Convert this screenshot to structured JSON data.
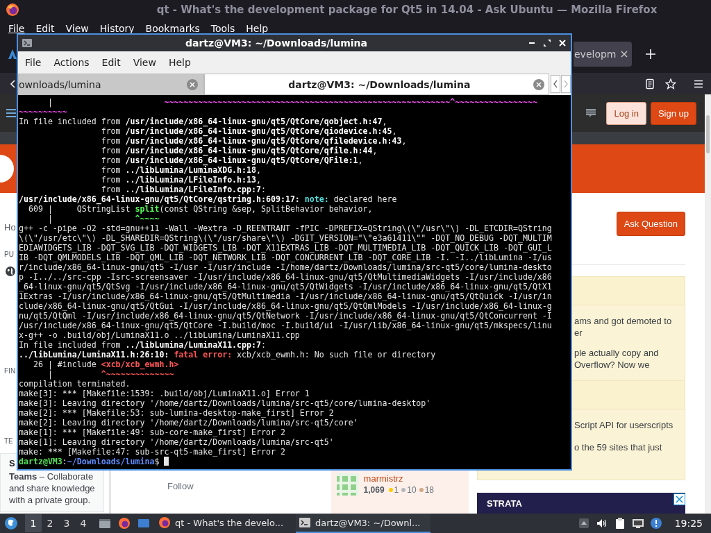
{
  "firefox": {
    "title": "qt - What's the development package for Qt5 in 14.04 - Ask Ubuntu — Mozilla Firefox",
    "menu": [
      "File",
      "Edit",
      "View",
      "History",
      "Bookmarks",
      "Tools",
      "Help"
    ],
    "tabs": [
      {
        "label": "evelopm",
        "selected": true
      }
    ],
    "page": {
      "header": {
        "login": "Log in",
        "signup": "Sign up"
      },
      "left_column": {
        "link": "Ho",
        "heading_1": "PU",
        "heading_2": "FIN",
        "heading_3": "TE",
        "card": {
          "title": "S",
          "text": "**Teams** – Collaborate and share knowledge with a private group."
        }
      },
      "main": {
        "follow": "Follow",
        "user_card": {
          "name": "marmistrz",
          "reputation": "1,069",
          "badges": [
            {
              "count": "1",
              "color": "#ffcc01"
            },
            {
              "count": "10",
              "color": "#b4b8bc"
            },
            {
              "count": "18",
              "color": "#d1a684"
            }
          ]
        }
      },
      "right_column": {
        "ask_button": "Ask Question",
        "sidebar_box": {
          "sections": [
            {
              "items": [
                {
                  "lines": [
                    "ams and got demoted to",
                    "er"
                  ]
                },
                {
                  "lines": [
                    "ple actually copy and",
                    "Overflow? Now we"
                  ]
                }
              ]
            },
            {
              "items": [
                {
                  "lines": [
                    "Script API for userscripts"
                  ]
                },
                {
                  "lines": [
                    "o the 59 sites that just"
                  ]
                }
              ]
            }
          ]
        },
        "ad": {
          "text": "STRATA"
        }
      }
    }
  },
  "terminal": {
    "title": "dartz@VM3: ~/Downloads/lumina",
    "menu": [
      "File",
      "Actions",
      "Edit",
      "View",
      "Help"
    ],
    "tabs": [
      {
        "label": "ownloads/lumina",
        "selected": false
      },
      {
        "label": "dartz@VM3: ~/Downloads/lumina",
        "selected": true
      }
    ],
    "lines": [
      [
        "      |                       ",
        {
          "kind": "magenta",
          "text": "~~~~~~~~~~~~~~~~~~~~~~~~~~~~~~~~~~~~~~~~~~~~~~~~~~~~~~~~~~~^~~~~~~~~~~~~~~~~~"
        }
      ],
      [
        {
          "kind": "magenta",
          "text": "~~~~~~~~~~"
        }
      ],
      [
        "In file included from ",
        {
          "kind": "bold",
          "text": "/usr/include/x86_64-linux-gnu/qt5/QtCore/qobject.h:47"
        },
        ","
      ],
      [
        "                 from ",
        {
          "kind": "bold",
          "text": "/usr/include/x86_64-linux-gnu/qt5/QtCore/qiodevice.h:45"
        },
        ","
      ],
      [
        "                 from ",
        {
          "kind": "bold",
          "text": "/usr/include/x86_64-linux-gnu/qt5/QtCore/qfiledevice.h:43"
        },
        ","
      ],
      [
        "                 from ",
        {
          "kind": "bold",
          "text": "/usr/include/x86_64-linux-gnu/qt5/QtCore/qfile.h:44"
        },
        ","
      ],
      [
        "                 from ",
        {
          "kind": "bold",
          "text": "/usr/include/x86_64-linux-gnu/qt5/QtCore/QFile:1"
        },
        ","
      ],
      [
        "                 from ",
        {
          "kind": "bold",
          "text": "../libLumina/LuminaXDG.h:18"
        },
        ","
      ],
      [
        "                 from ",
        {
          "kind": "bold",
          "text": "../libLumina/LFileInfo.h:13"
        },
        ","
      ],
      [
        "                 from ",
        {
          "kind": "bold",
          "text": "../libLumina/LFileInfo.cpp:7"
        },
        ":"
      ],
      [
        {
          "kind": "bold",
          "text": "/usr/include/x86_64-linux-gnu/qt5/QtCore/qstring.h:609:17: "
        },
        {
          "kind": "note",
          "text": "note:"
        },
        " declared here"
      ],
      [
        "  609 |     QStringList ",
        {
          "kind": "green",
          "text": "split"
        },
        "(const QString &sep, SplitBehavior behavior,"
      ],
      [
        "      |                 ",
        {
          "kind": "green",
          "text": "^~~~~"
        }
      ],
      [
        "g++ -c -pipe -O2 -std=gnu++11 -Wall -Wextra -D_REENTRANT -fPIC -DPREFIX=QString\\(\\\"/usr\\\"\\) -DL_ETCDIR=QString"
      ],
      [
        "\\(\\\"/usr/etc\\\"\\) -DL_SHAREDIR=QString\\(\\\"/usr/share\\\"\\) -DGIT_VERSION=\"\\\"e3a61411\\\"\" -DQT_NO_DEBUG -DQT_MULTIM"
      ],
      [
        "EDIAWIDGETS_LIB -DQT_SVG_LIB -DQT_WIDGETS_LIB -DQT_X11EXTRAS_LIB -DQT_MULTIMEDIA_LIB -DQT_QUICK_LIB -DQT_GUI_L"
      ],
      [
        "IB -DQT_QMLMODELS_LIB -DQT_QML_LIB -DQT_NETWORK_LIB -DQT_CONCURRENT_LIB -DQT_CORE_LIB -I. -I../libLumina -I/us"
      ],
      [
        "r/include/x86_64-linux-gnu/qt5 -I/usr -I/usr/include -I/home/dartz/Downloads/lumina/src-qt5/core/lumina-deskto"
      ],
      [
        "p -I../../src-cpp -Isrc-screensaver -I/usr/include/x86_64-linux-gnu/qt5/QtMultimediaWidgets -I/usr/include/x86"
      ],
      [
        "_64-linux-gnu/qt5/QtSvg -I/usr/include/x86_64-linux-gnu/qt5/QtWidgets -I/usr/include/x86_64-linux-gnu/qt5/QtX1"
      ],
      [
        "1Extras -I/usr/include/x86_64-linux-gnu/qt5/QtMultimedia -I/usr/include/x86_64-linux-gnu/qt5/QtQuick -I/usr/in"
      ],
      [
        "clude/x86_64-linux-gnu/qt5/QtGui -I/usr/include/x86_64-linux-gnu/qt5/QtQmlModels -I/usr/include/x86_64-linux-g"
      ],
      [
        "nu/qt5/QtQml -I/usr/include/x86_64-linux-gnu/qt5/QtNetwork -I/usr/include/x86_64-linux-gnu/qt5/QtConcurrent -I"
      ],
      [
        "/usr/include/x86_64-linux-gnu/qt5/QtCore -I.build/moc -I.build/ui -I/usr/lib/x86_64-linux-gnu/qt5/mkspecs/linu"
      ],
      [
        "x-g++ -o .build/obj/LuminaX11.o ../libLumina/LuminaX11.cpp"
      ],
      [
        "In file included from ",
        {
          "kind": "bold",
          "text": "../libLumina/LuminaX11.cpp:7"
        },
        ":"
      ],
      [
        {
          "kind": "bold",
          "text": "../libLumina/LuminaX11.h:26:10: "
        },
        {
          "kind": "error",
          "text": "fatal error:"
        },
        " xcb/xcb_ewmh.h: No such file or directory"
      ],
      [
        "   26 | #include ",
        {
          "kind": "error",
          "text": "<xcb/xcb_ewmh.h>"
        }
      ],
      [
        "      |          ",
        {
          "kind": "error",
          "text": "^~~~~~~~~~~~~~~"
        }
      ],
      [
        "compilation terminated."
      ],
      [
        "make[3]: *** [Makefile:1539: .build/obj/LuminaX11.o] Error 1"
      ],
      [
        "make[3]: Leaving directory '/home/dartz/Downloads/lumina/src-qt5/core/lumina-desktop'"
      ],
      [
        "make[2]: *** [Makefile:53: sub-lumina-desktop-make_first] Error 2"
      ],
      [
        "make[2]: Leaving directory '/home/dartz/Downloads/lumina/src-qt5/core'"
      ],
      [
        "make[1]: *** [Makefile:49: sub-core-make_first] Error 2"
      ],
      [
        "make[1]: Leaving directory '/home/dartz/Downloads/lumina/src-qt5'"
      ],
      [
        "make: *** [Makefile:47: sub-src-qt5-make_first] Error 2"
      ]
    ],
    "prompt": [
      {
        "kind": "user",
        "text": "dartz@VM3"
      },
      ":",
      {
        "kind": "path",
        "text": "~/Downloads/lumina"
      },
      "$ "
    ]
  },
  "taskbar": {
    "workspaces": [
      {
        "label": "1",
        "selected": true
      },
      {
        "label": "2",
        "selected": false
      },
      {
        "label": "3",
        "selected": false
      },
      {
        "label": "4",
        "selected": false
      }
    ],
    "tasks": [
      {
        "kind": "browser",
        "label": "qt - What's the develo...",
        "selected": false
      },
      {
        "kind": "terminal",
        "label": "dartz@VM3: ~/Downl...",
        "selected": true
      }
    ],
    "clock": "19:25"
  }
}
